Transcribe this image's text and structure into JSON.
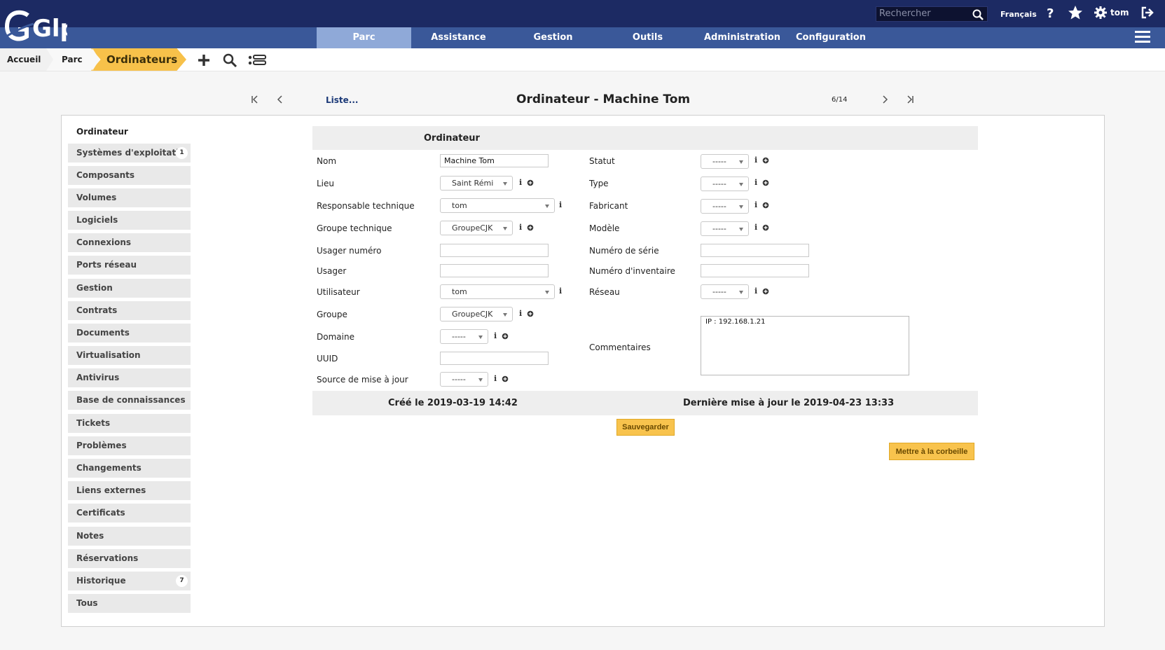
{
  "header": {
    "logo_text": "Glpi",
    "search_placeholder": "Rechercher",
    "language": "Français",
    "help_label": "?",
    "user": "tom"
  },
  "menu": {
    "items": [
      {
        "label": "Parc",
        "active": true
      },
      {
        "label": "Assistance",
        "active": false
      },
      {
        "label": "Gestion",
        "active": false
      },
      {
        "label": "Outils",
        "active": false
      },
      {
        "label": "Administration",
        "active": false
      },
      {
        "label": "Configuration",
        "active": false
      }
    ]
  },
  "breadcrumb": {
    "home": "Accueil",
    "parc": "Parc",
    "current": "Ordinateurs"
  },
  "toolbar": {
    "icons": [
      "plus-icon",
      "search-icon",
      "list-icon"
    ]
  },
  "record_nav": {
    "list_link": "Liste...",
    "title": "Ordinateur - Machine Tom",
    "pager": "6/14"
  },
  "sidebar": {
    "heading": "Ordinateur",
    "tabs": [
      {
        "label": "Systèmes d'exploitati..",
        "badge": "1"
      },
      {
        "label": "Composants",
        "badge": ""
      },
      {
        "label": "Volumes",
        "badge": ""
      },
      {
        "label": "Logiciels",
        "badge": ""
      },
      {
        "label": "Connexions",
        "badge": ""
      },
      {
        "label": "Ports réseau",
        "badge": ""
      },
      {
        "label": "Gestion",
        "badge": ""
      },
      {
        "label": "Contrats",
        "badge": ""
      },
      {
        "label": "Documents",
        "badge": ""
      },
      {
        "label": "Virtualisation",
        "badge": ""
      },
      {
        "label": "Antivirus",
        "badge": ""
      },
      {
        "label": "Base de connaissances",
        "badge": ""
      },
      {
        "label": "Tickets",
        "badge": ""
      },
      {
        "label": "Problèmes",
        "badge": ""
      },
      {
        "label": "Changements",
        "badge": ""
      },
      {
        "label": "Liens externes",
        "badge": ""
      },
      {
        "label": "Certificats",
        "badge": ""
      },
      {
        "label": "Notes",
        "badge": ""
      },
      {
        "label": "Réservations",
        "badge": ""
      },
      {
        "label": "Historique",
        "badge": "7"
      },
      {
        "label": "Tous",
        "badge": ""
      }
    ]
  },
  "form": {
    "section_title": "Ordinateur",
    "left": {
      "nom": {
        "label": "Nom",
        "value": "Machine Tom"
      },
      "lieu": {
        "label": "Lieu",
        "value": "Saint Rémi"
      },
      "resp_tech": {
        "label": "Responsable technique",
        "value": "tom"
      },
      "groupe_tech": {
        "label": "Groupe technique",
        "value": "GroupeCJK"
      },
      "usager_num": {
        "label": "Usager numéro",
        "value": ""
      },
      "usager": {
        "label": "Usager",
        "value": ""
      },
      "utilisateur": {
        "label": "Utilisateur",
        "value": "tom"
      },
      "groupe": {
        "label": "Groupe",
        "value": "GroupeCJK"
      },
      "domaine": {
        "label": "Domaine",
        "value": "-----"
      },
      "uuid": {
        "label": "UUID",
        "value": ""
      },
      "source": {
        "label": "Source de mise à jour",
        "value": "-----"
      }
    },
    "right": {
      "statut": {
        "label": "Statut",
        "value": "-----"
      },
      "type": {
        "label": "Type",
        "value": "-----"
      },
      "fabricant": {
        "label": "Fabricant",
        "value": "-----"
      },
      "modele": {
        "label": "Modèle",
        "value": "-----"
      },
      "serie": {
        "label": "Numéro de série",
        "value": ""
      },
      "inventaire": {
        "label": "Numéro d'inventaire",
        "value": ""
      },
      "reseau": {
        "label": "Réseau",
        "value": "-----"
      },
      "commentaires": {
        "label": "Commentaires",
        "value": "IP : 192.168.1.21"
      }
    },
    "info_icon": "i",
    "created": "Créé le 2019-03-19 14:42",
    "updated": "Dernière mise à jour le 2019-04-23 13:33",
    "save_label": "Sauvegarder",
    "trash_label": "Mettre à la corbeille"
  }
}
